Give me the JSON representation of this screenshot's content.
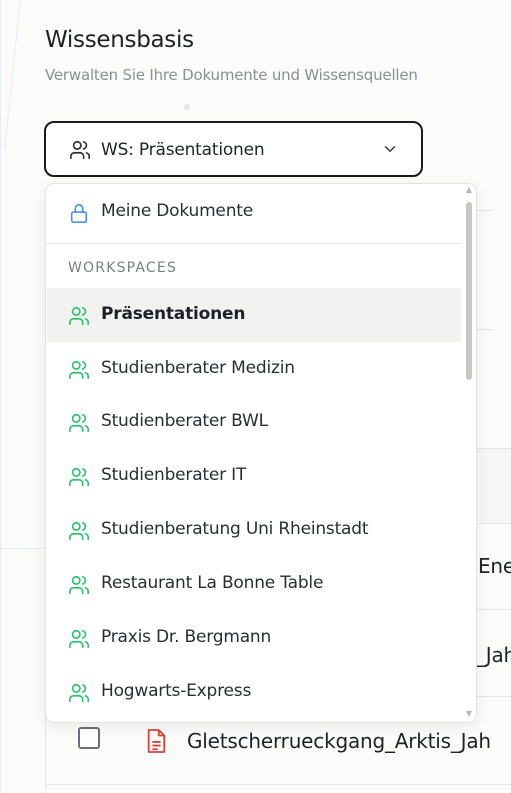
{
  "page": {
    "title": "Wissensbasis",
    "subtitle": "Verwalten Sie Ihre Dokumente und Wissensquellen"
  },
  "workspace_select": {
    "icon": "users-icon",
    "value": "WS: Präsentationen",
    "chevron": "chevron-down-icon"
  },
  "dropdown": {
    "personal": {
      "label": "Meine Dokumente",
      "icon": "lock-icon"
    },
    "section_label": "WORKSPACES",
    "workspaces": [
      {
        "label": "Präsentationen",
        "selected": true
      },
      {
        "label": "Studienberater Medizin"
      },
      {
        "label": "Studienberater BWL"
      },
      {
        "label": "Studienberater IT"
      },
      {
        "label": "Studienberatung Uni Rheinstadt"
      },
      {
        "label": "Restaurant La Bonne Table"
      },
      {
        "label": "Praxis Dr. Bergmann"
      },
      {
        "label": "Hogwarts-Express"
      }
    ],
    "colors": {
      "workspace_icon": "#2fbf71",
      "lock_icon": "#4f8fe0"
    }
  },
  "background_rows": {
    "row1_partial": "Ene",
    "row2_partial": "_Jah",
    "row3_filename": "Gletscherrueckgang_Arktis_Jah",
    "file_icon": "pdf-file-icon",
    "file_icon_color": "#d8443c"
  }
}
